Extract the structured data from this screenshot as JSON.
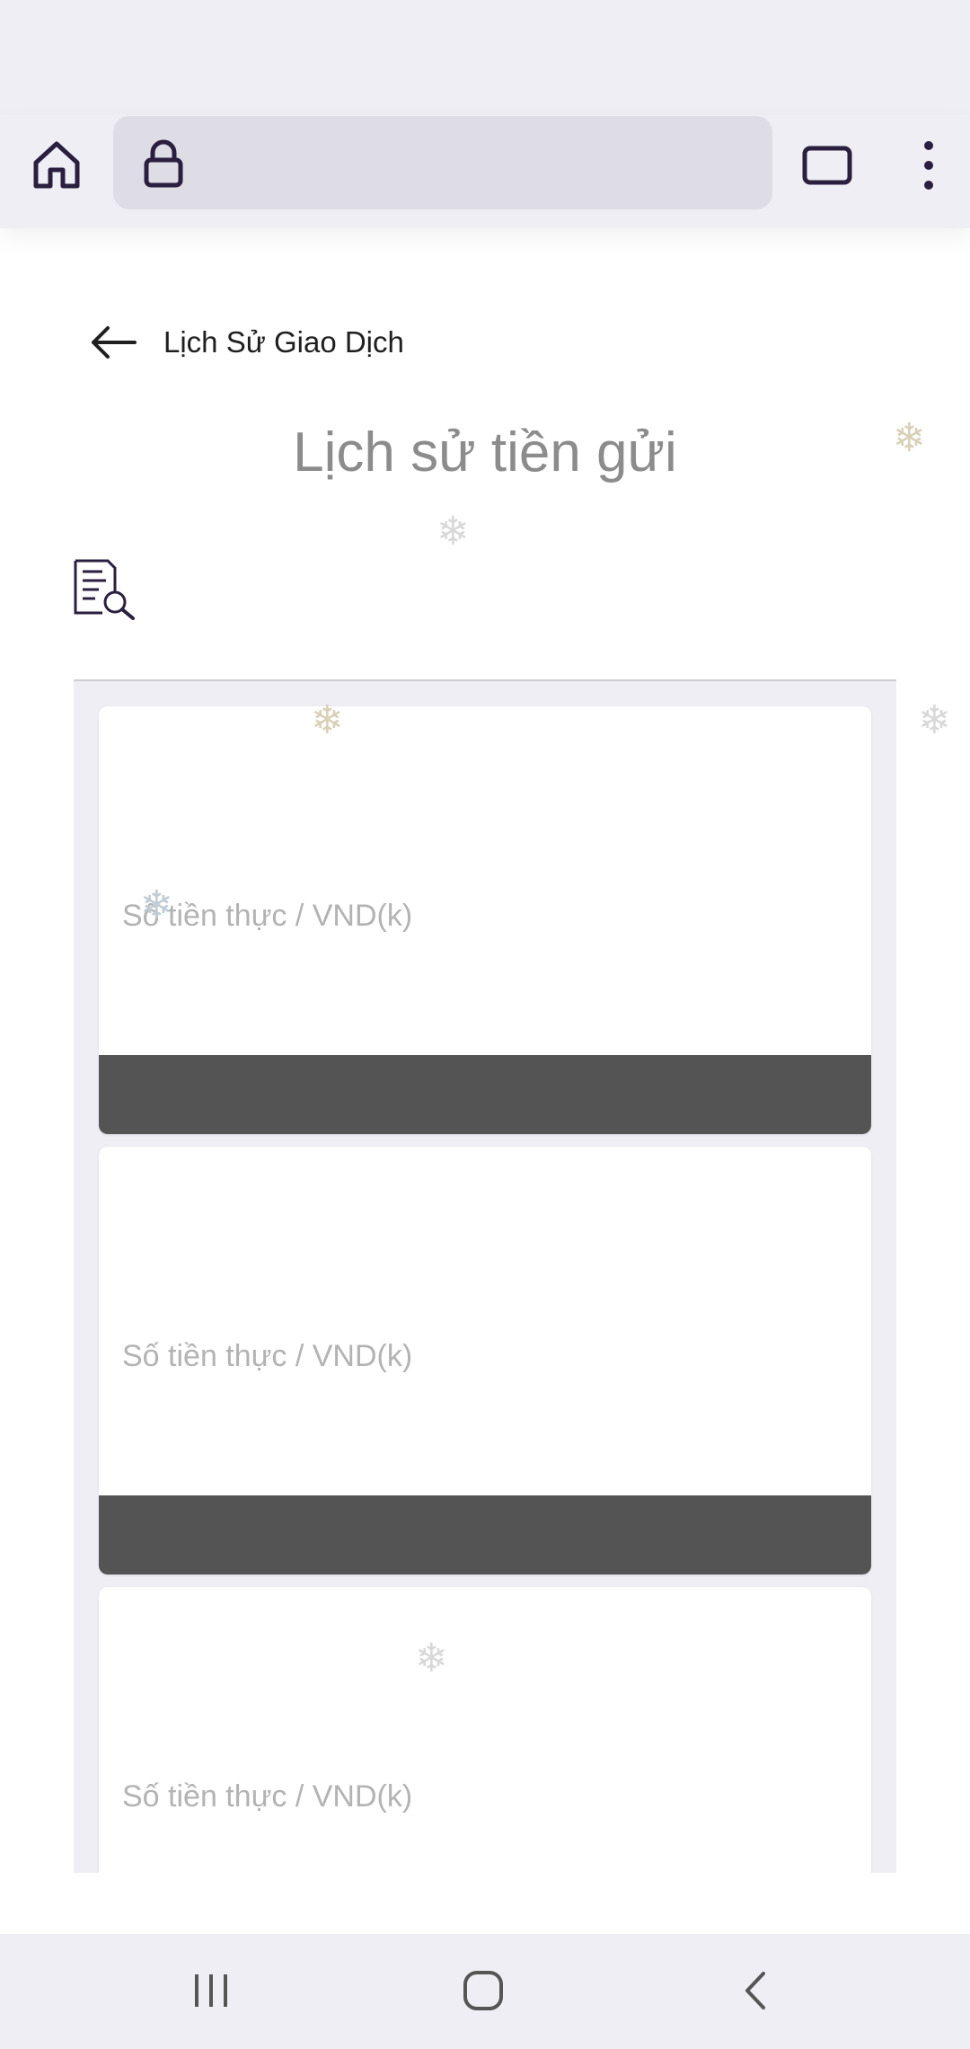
{
  "browser": {
    "url": ""
  },
  "header": {
    "back_label": "Lịch Sử Giao Dịch",
    "page_title": "Lịch sử tiền gửi"
  },
  "cards": [
    {
      "amount_label": "Số tiền thực / VND(k)"
    },
    {
      "amount_label": "Số tiền thực / VND(k)"
    },
    {
      "amount_label": "Số tiền thực / VND(k)"
    }
  ],
  "icons": {
    "home": "home-icon",
    "lock": "lock-icon",
    "tabs": "tabs-icon",
    "menu": "more-vertical-icon",
    "back": "arrow-left-icon",
    "filter": "document-search-icon",
    "nav_recent": "recent-apps-icon",
    "nav_home": "home-circle-icon",
    "nav_back": "chevron-left-icon"
  },
  "colors": {
    "chrome_bg": "#efeef5",
    "url_bg": "#dedde5",
    "icon_dark": "#2b1f3f",
    "card_bar": "#545454",
    "label_grey": "#b3b3b3"
  }
}
